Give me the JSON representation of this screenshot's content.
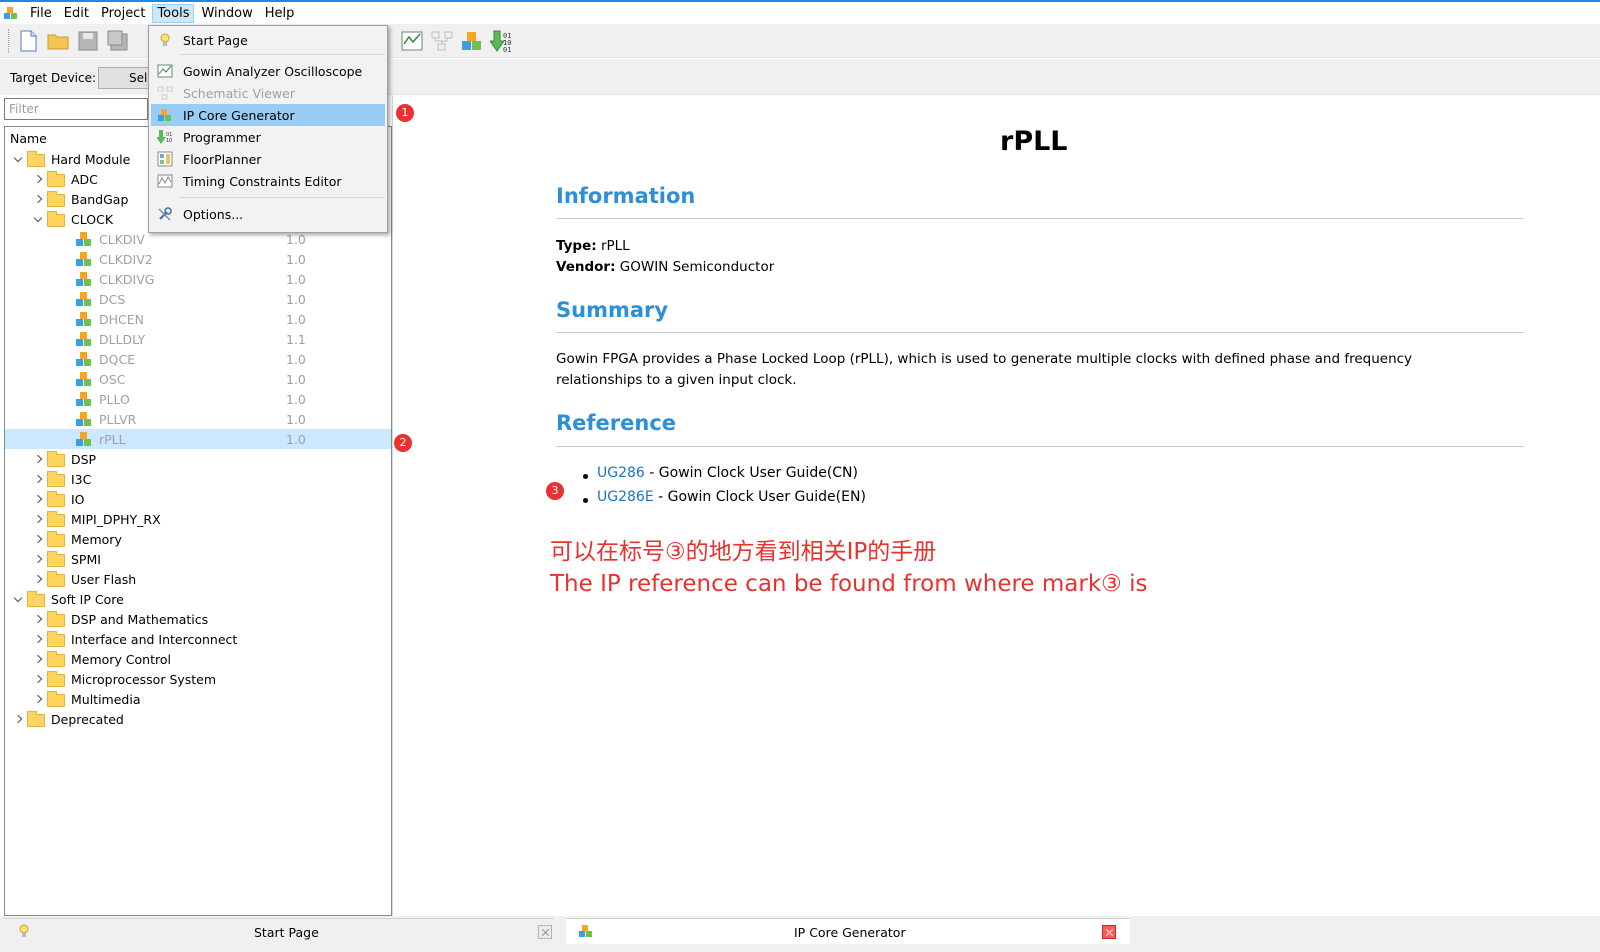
{
  "menubar": {
    "items": [
      "File",
      "Edit",
      "Project",
      "Tools",
      "Window",
      "Help"
    ],
    "active": "Tools"
  },
  "target": {
    "label": "Target Device:",
    "select_label": "Sele"
  },
  "filter": {
    "placeholder": "Filter"
  },
  "tree": {
    "header": "Name",
    "hard_module": "Hard Module",
    "adc": "ADC",
    "bandgap": "BandGap",
    "clock": "CLOCK",
    "clock_items": [
      {
        "name": "CLKDIV",
        "version": "1.0"
      },
      {
        "name": "CLKDIV2",
        "version": "1.0"
      },
      {
        "name": "CLKDIVG",
        "version": "1.0"
      },
      {
        "name": "DCS",
        "version": "1.0"
      },
      {
        "name": "DHCEN",
        "version": "1.0"
      },
      {
        "name": "DLLDLY",
        "version": "1.1"
      },
      {
        "name": "DQCE",
        "version": "1.0"
      },
      {
        "name": "OSC",
        "version": "1.0"
      },
      {
        "name": "PLLO",
        "version": "1.0"
      },
      {
        "name": "PLLVR",
        "version": "1.0"
      },
      {
        "name": "rPLL",
        "version": "1.0"
      }
    ],
    "hard_rest": [
      "DSP",
      "I3C",
      "IO",
      "MIPI_DPHY_RX",
      "Memory",
      "SPMI",
      "User Flash"
    ],
    "soft_ip_core": "Soft IP Core",
    "soft_items": [
      "DSP and Mathematics",
      "Interface and Interconnect",
      "Memory Control",
      "Microprocessor System",
      "Multimedia"
    ],
    "deprecated": "Deprecated"
  },
  "tools_menu": {
    "start_page": "Start Page",
    "analyzer": "Gowin Analyzer Oscilloscope",
    "schematic": "Schematic Viewer",
    "ip_core": "IP Core Generator",
    "programmer": "Programmer",
    "floorplanner": "FloorPlanner",
    "timing": "Timing Constraints Editor",
    "options": "Options..."
  },
  "doc": {
    "title": "rPLL",
    "information_heading": "Information",
    "type_label": "Type:",
    "type_value": "rPLL",
    "vendor_label": "Vendor:",
    "vendor_value": "GOWIN Semiconductor",
    "summary_heading": "Summary",
    "summary_line1": "Gowin FPGA provides a Phase Locked Loop (rPLL), which is used to generate multiple clocks with defined phase and frequency",
    "summary_line2": "relationships to a given input clock.",
    "reference_heading": "Reference",
    "refs": [
      {
        "link": "UG286",
        "text": " - Gowin Clock User Guide(CN)"
      },
      {
        "link": "UG286E",
        "text": " - Gowin Clock User Guide(EN)"
      }
    ]
  },
  "annotation": {
    "line_cn": "可以在标号③的地方看到相关IP的手册",
    "line_en": "The IP reference can be found from where mark③ is"
  },
  "markers": [
    "1",
    "2",
    "3"
  ],
  "bottom_tabs": {
    "start_page": "Start Page",
    "ip_core": "IP Core Generator"
  },
  "colors": {
    "heading": "#2e8fd9",
    "link": "#1a73c8",
    "annotation": "#e8322e",
    "selection": "#cce8ff"
  }
}
